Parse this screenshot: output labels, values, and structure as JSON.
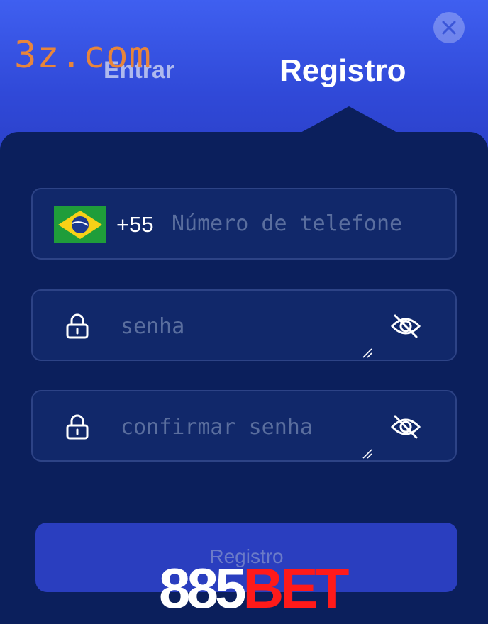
{
  "watermark": "3z.com",
  "tabs": {
    "login": "Entrar",
    "register": "Registro"
  },
  "close_icon": "close-icon",
  "phone": {
    "flag_icon": "brazil-flag-icon",
    "country_code": "+55",
    "placeholder": "Número de telefone"
  },
  "password": {
    "placeholder": "senha",
    "lock_icon": "lock-icon",
    "visibility_icon": "eye-slash-icon"
  },
  "confirm_password": {
    "placeholder": "confirmar senha",
    "lock_icon": "lock-icon",
    "visibility_icon": "eye-slash-icon"
  },
  "submit": {
    "label": "Registro"
  },
  "brand": {
    "number": "885",
    "suffix": "BET"
  },
  "colors": {
    "header_top": "#3f5ff0",
    "panel": "#0b1f5c",
    "watermark": "#e8853b",
    "brand_red": "#ff1a1a"
  }
}
